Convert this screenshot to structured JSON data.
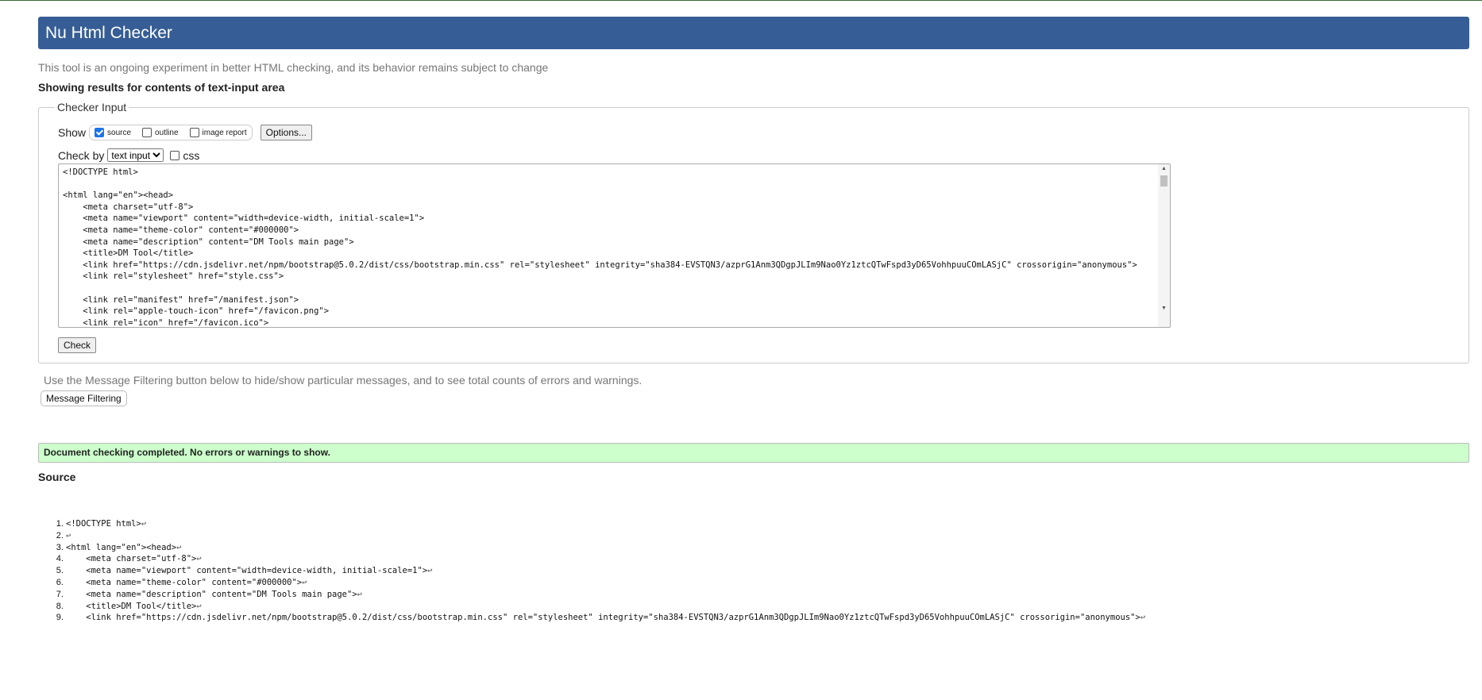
{
  "header": {
    "title": "Nu Html Checker"
  },
  "subtitle": "This tool is an ongoing experiment in better HTML checking, and its behavior remains subject to change",
  "showing": "Showing results for contents of text-input area",
  "checker_input": {
    "legend": "Checker Input",
    "show_label": "Show",
    "show_options": [
      {
        "label": "source",
        "checked": true
      },
      {
        "label": "outline",
        "checked": false
      },
      {
        "label": "image report",
        "checked": false
      }
    ],
    "options_button": "Options...",
    "check_by_label": "Check by",
    "check_by_value": "text input",
    "css_label": "css",
    "css_checked": false,
    "textarea_value": "<!DOCTYPE html>\n\n<html lang=\"en\"><head>\n    <meta charset=\"utf-8\">\n    <meta name=\"viewport\" content=\"width=device-width, initial-scale=1\">\n    <meta name=\"theme-color\" content=\"#000000\">\n    <meta name=\"description\" content=\"DM Tools main page\">\n    <title>DM Tool</title>\n    <link href=\"https://cdn.jsdelivr.net/npm/bootstrap@5.0.2/dist/css/bootstrap.min.css\" rel=\"stylesheet\" integrity=\"sha384-EVSTQN3/azprG1Anm3QDgpJLIm9Nao0Yz1ztcQTwFspd3yD65VohhpuuCOmLASjC\" crossorigin=\"anonymous\">\n    <link rel=\"stylesheet\" href=\"style.css\">\n\n    <link rel=\"manifest\" href=\"/manifest.json\">\n    <link rel=\"apple-touch-icon\" href=\"/favicon.png\">\n    <link rel=\"icon\" href=\"/favicon.ico\">",
    "check_button": "Check"
  },
  "filter_message": "Use the Message Filtering button below to hide/show particular messages, and to see total counts of errors and warnings.",
  "filter_button": "Message Filtering",
  "result": "Document checking completed. No errors or warnings to show.",
  "source_heading": "Source",
  "source_lines": [
    "<!DOCTYPE html>",
    "",
    "<html lang=\"en\"><head>",
    "    <meta charset=\"utf-8\">",
    "    <meta name=\"viewport\" content=\"width=device-width, initial-scale=1\">",
    "    <meta name=\"theme-color\" content=\"#000000\">",
    "    <meta name=\"description\" content=\"DM Tools main page\">",
    "    <title>DM Tool</title>",
    "    <link href=\"https://cdn.jsdelivr.net/npm/bootstrap@5.0.2/dist/css/bootstrap.min.css\" rel=\"stylesheet\" integrity=\"sha384-EVSTQN3/azprG1Anm3QDgpJLIm9Nao0Yz1ztcQTwFspd3yD65VohhpuuCOmLASjC\" crossorigin=\"anonymous\">"
  ],
  "colors": {
    "header": "#365d95",
    "success": "#ccffcc"
  }
}
